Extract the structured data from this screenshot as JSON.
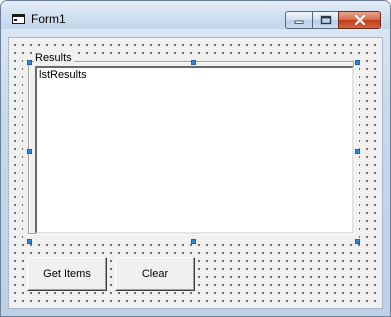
{
  "window": {
    "title": "Form1",
    "icon": "vb-form-icon",
    "caption_buttons": [
      "minimize-icon",
      "maximize-icon",
      "close-icon"
    ]
  },
  "frame": {
    "caption": "Results"
  },
  "listbox": {
    "items": [
      "lstResults"
    ]
  },
  "buttons": {
    "get_items": "Get Items",
    "clear": "Clear"
  },
  "colors": {
    "close_button": "#c0391b",
    "selection_handle": "#2b8ae2"
  }
}
